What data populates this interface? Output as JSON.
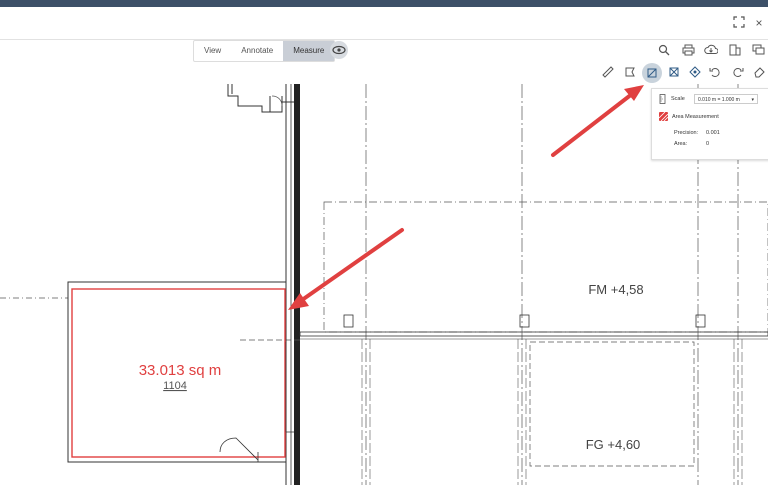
{
  "window": {
    "fullscreen_icon": "expand-icon",
    "close_label": "×"
  },
  "modes": {
    "view": "View",
    "annotate": "Annotate",
    "measure": "Measure"
  },
  "panel": {
    "scale_label": "Scale",
    "scale_value": "0.010 m = 1.000 m",
    "mode_label": "Area Measurement",
    "precision_label": "Precision:",
    "precision_value": "0.001",
    "area_label": "Area:",
    "area_value": "0"
  },
  "drawing": {
    "area_label": "33.013 sq m",
    "room_number": "1104",
    "fm_label": "FM +4,58",
    "fg_label": "FG +4,60"
  },
  "colors": {
    "accent_red": "#e04040",
    "header": "#3d5068"
  }
}
